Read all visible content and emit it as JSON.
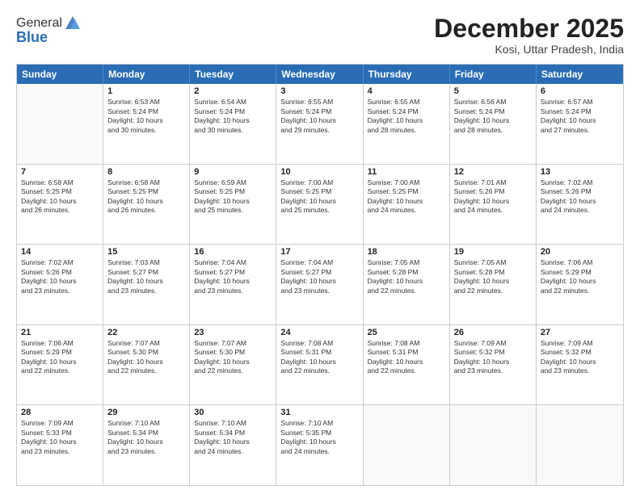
{
  "header": {
    "logo_general": "General",
    "logo_blue": "Blue",
    "month_title": "December 2025",
    "location": "Kosi, Uttar Pradesh, India"
  },
  "days_of_week": [
    "Sunday",
    "Monday",
    "Tuesday",
    "Wednesday",
    "Thursday",
    "Friday",
    "Saturday"
  ],
  "weeks": [
    [
      {
        "day": "",
        "sunrise": "",
        "sunset": "",
        "daylight": ""
      },
      {
        "day": "1",
        "sunrise": "Sunrise: 6:53 AM",
        "sunset": "Sunset: 5:24 PM",
        "daylight": "Daylight: 10 hours and 30 minutes."
      },
      {
        "day": "2",
        "sunrise": "Sunrise: 6:54 AM",
        "sunset": "Sunset: 5:24 PM",
        "daylight": "Daylight: 10 hours and 30 minutes."
      },
      {
        "day": "3",
        "sunrise": "Sunrise: 6:55 AM",
        "sunset": "Sunset: 5:24 PM",
        "daylight": "Daylight: 10 hours and 29 minutes."
      },
      {
        "day": "4",
        "sunrise": "Sunrise: 6:55 AM",
        "sunset": "Sunset: 5:24 PM",
        "daylight": "Daylight: 10 hours and 28 minutes."
      },
      {
        "day": "5",
        "sunrise": "Sunrise: 6:56 AM",
        "sunset": "Sunset: 5:24 PM",
        "daylight": "Daylight: 10 hours and 28 minutes."
      },
      {
        "day": "6",
        "sunrise": "Sunrise: 6:57 AM",
        "sunset": "Sunset: 5:24 PM",
        "daylight": "Daylight: 10 hours and 27 minutes."
      }
    ],
    [
      {
        "day": "7",
        "sunrise": "Sunrise: 6:58 AM",
        "sunset": "Sunset: 5:25 PM",
        "daylight": "Daylight: 10 hours and 26 minutes."
      },
      {
        "day": "8",
        "sunrise": "Sunrise: 6:58 AM",
        "sunset": "Sunset: 5:25 PM",
        "daylight": "Daylight: 10 hours and 26 minutes."
      },
      {
        "day": "9",
        "sunrise": "Sunrise: 6:59 AM",
        "sunset": "Sunset: 5:25 PM",
        "daylight": "Daylight: 10 hours and 25 minutes."
      },
      {
        "day": "10",
        "sunrise": "Sunrise: 7:00 AM",
        "sunset": "Sunset: 5:25 PM",
        "daylight": "Daylight: 10 hours and 25 minutes."
      },
      {
        "day": "11",
        "sunrise": "Sunrise: 7:00 AM",
        "sunset": "Sunset: 5:25 PM",
        "daylight": "Daylight: 10 hours and 24 minutes."
      },
      {
        "day": "12",
        "sunrise": "Sunrise: 7:01 AM",
        "sunset": "Sunset: 5:26 PM",
        "daylight": "Daylight: 10 hours and 24 minutes."
      },
      {
        "day": "13",
        "sunrise": "Sunrise: 7:02 AM",
        "sunset": "Sunset: 5:26 PM",
        "daylight": "Daylight: 10 hours and 24 minutes."
      }
    ],
    [
      {
        "day": "14",
        "sunrise": "Sunrise: 7:02 AM",
        "sunset": "Sunset: 5:26 PM",
        "daylight": "Daylight: 10 hours and 23 minutes."
      },
      {
        "day": "15",
        "sunrise": "Sunrise: 7:03 AM",
        "sunset": "Sunset: 5:27 PM",
        "daylight": "Daylight: 10 hours and 23 minutes."
      },
      {
        "day": "16",
        "sunrise": "Sunrise: 7:04 AM",
        "sunset": "Sunset: 5:27 PM",
        "daylight": "Daylight: 10 hours and 23 minutes."
      },
      {
        "day": "17",
        "sunrise": "Sunrise: 7:04 AM",
        "sunset": "Sunset: 5:27 PM",
        "daylight": "Daylight: 10 hours and 23 minutes."
      },
      {
        "day": "18",
        "sunrise": "Sunrise: 7:05 AM",
        "sunset": "Sunset: 5:28 PM",
        "daylight": "Daylight: 10 hours and 22 minutes."
      },
      {
        "day": "19",
        "sunrise": "Sunrise: 7:05 AM",
        "sunset": "Sunset: 5:28 PM",
        "daylight": "Daylight: 10 hours and 22 minutes."
      },
      {
        "day": "20",
        "sunrise": "Sunrise: 7:06 AM",
        "sunset": "Sunset: 5:29 PM",
        "daylight": "Daylight: 10 hours and 22 minutes."
      }
    ],
    [
      {
        "day": "21",
        "sunrise": "Sunrise: 7:06 AM",
        "sunset": "Sunset: 5:29 PM",
        "daylight": "Daylight: 10 hours and 22 minutes."
      },
      {
        "day": "22",
        "sunrise": "Sunrise: 7:07 AM",
        "sunset": "Sunset: 5:30 PM",
        "daylight": "Daylight: 10 hours and 22 minutes."
      },
      {
        "day": "23",
        "sunrise": "Sunrise: 7:07 AM",
        "sunset": "Sunset: 5:30 PM",
        "daylight": "Daylight: 10 hours and 22 minutes."
      },
      {
        "day": "24",
        "sunrise": "Sunrise: 7:08 AM",
        "sunset": "Sunset: 5:31 PM",
        "daylight": "Daylight: 10 hours and 22 minutes."
      },
      {
        "day": "25",
        "sunrise": "Sunrise: 7:08 AM",
        "sunset": "Sunset: 5:31 PM",
        "daylight": "Daylight: 10 hours and 22 minutes."
      },
      {
        "day": "26",
        "sunrise": "Sunrise: 7:09 AM",
        "sunset": "Sunset: 5:32 PM",
        "daylight": "Daylight: 10 hours and 23 minutes."
      },
      {
        "day": "27",
        "sunrise": "Sunrise: 7:09 AM",
        "sunset": "Sunset: 5:32 PM",
        "daylight": "Daylight: 10 hours and 23 minutes."
      }
    ],
    [
      {
        "day": "28",
        "sunrise": "Sunrise: 7:09 AM",
        "sunset": "Sunset: 5:33 PM",
        "daylight": "Daylight: 10 hours and 23 minutes."
      },
      {
        "day": "29",
        "sunrise": "Sunrise: 7:10 AM",
        "sunset": "Sunset: 5:34 PM",
        "daylight": "Daylight: 10 hours and 23 minutes."
      },
      {
        "day": "30",
        "sunrise": "Sunrise: 7:10 AM",
        "sunset": "Sunset: 5:34 PM",
        "daylight": "Daylight: 10 hours and 24 minutes."
      },
      {
        "day": "31",
        "sunrise": "Sunrise: 7:10 AM",
        "sunset": "Sunset: 5:35 PM",
        "daylight": "Daylight: 10 hours and 24 minutes."
      },
      {
        "day": "",
        "sunrise": "",
        "sunset": "",
        "daylight": ""
      },
      {
        "day": "",
        "sunrise": "",
        "sunset": "",
        "daylight": ""
      },
      {
        "day": "",
        "sunrise": "",
        "sunset": "",
        "daylight": ""
      }
    ]
  ]
}
